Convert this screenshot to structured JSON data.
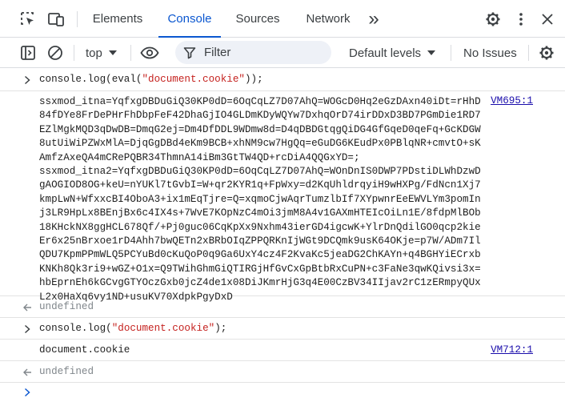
{
  "tabs": {
    "items": [
      {
        "label": "Elements"
      },
      {
        "label": "Console"
      },
      {
        "label": "Sources"
      },
      {
        "label": "Network"
      }
    ],
    "more": "»"
  },
  "toolbar": {
    "context": "top",
    "filter_placeholder": "Filter",
    "levels": "Default levels",
    "issues": "No Issues"
  },
  "console": {
    "cmd1": {
      "prefix": "console.log(eval(",
      "string": "\"document.cookie\"",
      "suffix": "));"
    },
    "log1": {
      "text": "ssxmod_itna=YqfxgDBDuGiQ30KP0dD=6OqCqLZ7D07AhQ=WOGcD0Hq2eGzDAxn40iDt=rHhD84fDYe8FrDePHrFhDbpFeF42DhaGjIO4GLDmKDyWQYw7DxhqOrD74irDDxD3BD7PGmDie1RD7EZlMgkMQD3qDwDB=DmqG2ej=Dm4DfDDL9WDmw8d=D4qDBDGtqgQiDG4GfGqeD0qeFq+GcKDGW8utUiWiPZWxMlA=DjqGgDBd4eKm9BCB+xhNM9cw7HgQq=eGuDG6KEudPx0PBlqNR+cmvtO+sKAmfzAxeQA4mCRePQBR34ThmnA14iBm3GtTW4QD+rcDiA4QQGxYD=;",
      "text2": "ssxmod_itna2=YqfxgDBDuGiQ30KP0dD=6OqCqLZ7D07AhQ=WOnDnIS0DWP7PDstiDLWhDzwDgAOGIOD8OG+keU=nYUKl7tGvbI=W+qr2KYR1q+FpWxy=d2KqUhldrqyiH9wHXPg/FdNcn1Xj7kmpLwN+WfxxcBI4OboA3+ix1mEqTjre=Q=xqmoCjwAqrTumzlbIf7XYpwnrEeEWVLYm3pomInj3LR9HpLx8BEnjBx6c4IX4s+7WvE7KOpNzC4mOi3jmM8A4v1GAXmHTEIcOiLn1E/8fdpMlBOb18KHckNX8ggHCL678Qf/+Pj0guc06CqKpXx9Nxhm43ierGD4igcwK+YlrDnQdilGO0qcp2kieEr6x25nBrxoe1rD4Ahh7bwQETn2xBRbOIqZPPQRKnIjWGt9DCQmk9usK64OKje=p7W/ADm7IlQDU7KpmPPmWLQ5PCYuBd0cKuQoP0q9Ga6UxY4cz4F2KvaKc5jeaDG2ChKAYn+q4BGHYiECrxbKNKh8Qk3ri9+wGZ+O1x=Q9TWihGhmGiQTIRGjHfGvCxGpBtbRxCuPN+c3FaNe3qwKQivsi3x=hbEprnEh6kGCvgGTYOczGxb0jcZ4de1x08DiJKmrHjG3q4E00CzBV34IIjav2rC1zERmpyQUxL2x0HaXq6vy1ND+usuKV70XdpkPgyDxD",
      "src": "VM695:1"
    },
    "undef1": "undefined",
    "cmd2": {
      "prefix": "console.log(",
      "string": "\"document.cookie\"",
      "suffix": ");"
    },
    "log2": {
      "text": "document.cookie",
      "src": "VM712:1"
    },
    "undef2": "undefined"
  },
  "colors": {
    "accent": "#0b57d0",
    "string": "#c5221f",
    "link": "#1a0dab",
    "muted": "#80868b"
  }
}
